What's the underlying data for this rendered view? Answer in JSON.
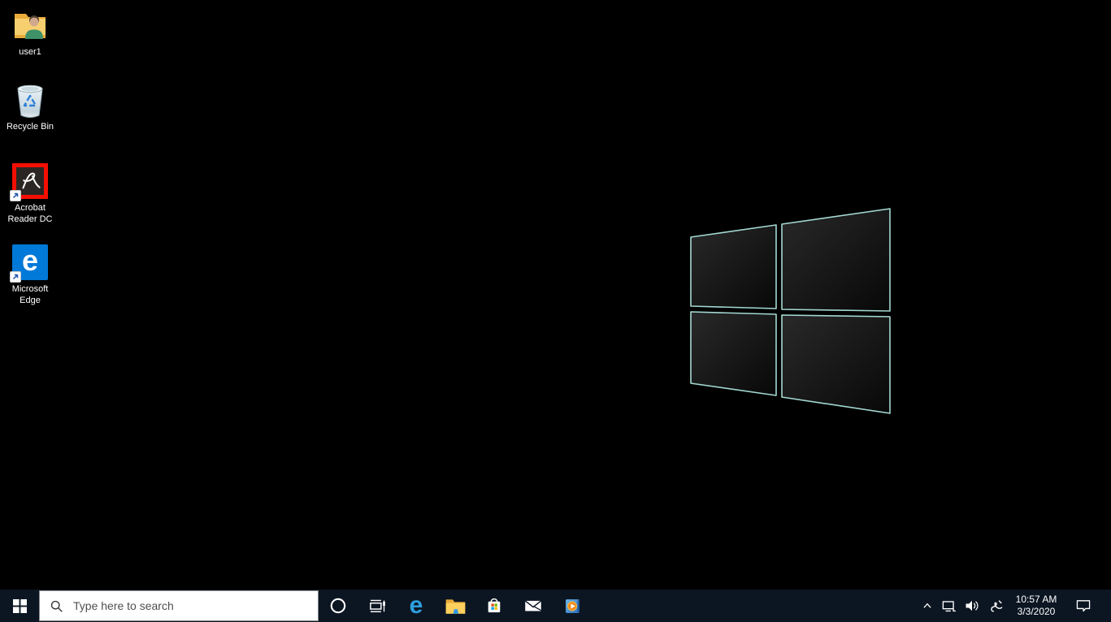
{
  "desktop": {
    "icons": [
      {
        "name": "user-folder",
        "label": "user1"
      },
      {
        "name": "recycle-bin",
        "label": "Recycle Bin"
      },
      {
        "name": "acrobat-reader",
        "label": "Acrobat Reader DC"
      },
      {
        "name": "microsoft-edge",
        "label": "Microsoft Edge"
      }
    ]
  },
  "taskbar": {
    "search_placeholder": "Type here to search",
    "edge_glyph": "e",
    "icon_names": [
      "start-icon",
      "search-icon",
      "cortana-icon",
      "task-view-icon",
      "edge-icon",
      "file-explorer-icon",
      "store-icon",
      "mail-icon",
      "media-player-icon"
    ],
    "tray": {
      "time": "10:57 AM",
      "date": "3/3/2020",
      "icon_names": [
        "chevron-up-icon",
        "network-icon",
        "volume-icon",
        "ink-workspace-icon",
        "action-center-icon"
      ]
    }
  },
  "colors": {
    "taskbar_bg": "#0c1622",
    "search_box_bg": "#ffffff",
    "search_text": "#4f4f4f",
    "wallpaper_azure": "#0d9ff0",
    "wallpaper_deep_blue": "#1b49bb",
    "logo_edge": "#aef4ec",
    "edge_blue": "#0079d8",
    "acrobat_red": "#f40f02",
    "store_red": "#f25022",
    "store_green": "#7fba00",
    "store_blue": "#00a4ef",
    "store_yellow": "#ffb900",
    "media_orange": "#ef8b1d",
    "folder_gold": "#f3b84a"
  }
}
